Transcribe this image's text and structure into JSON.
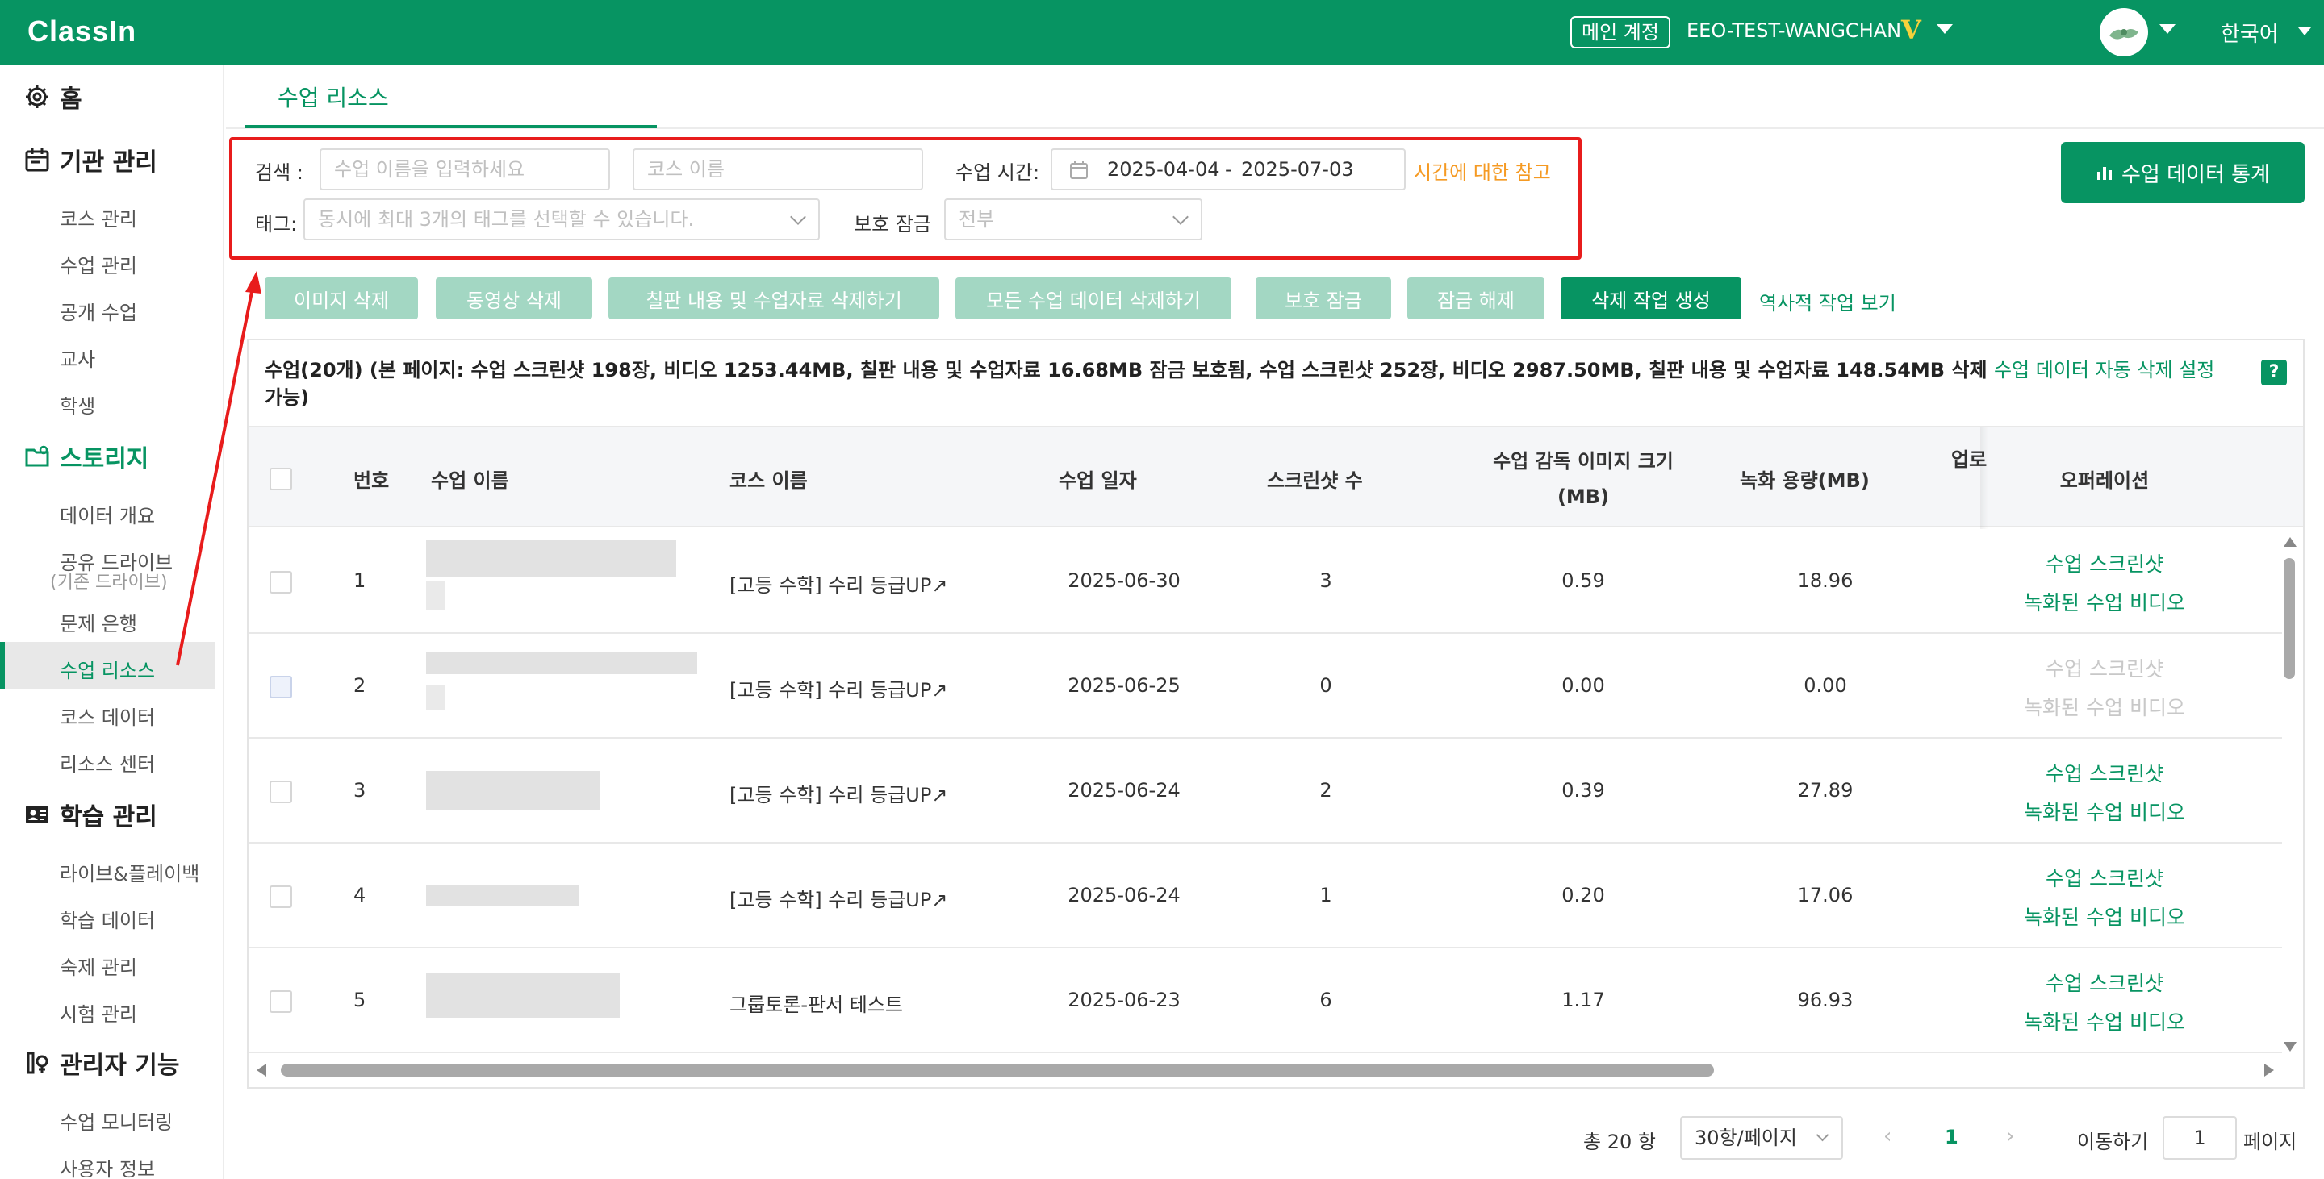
{
  "header": {
    "logo": "ClassIn",
    "account_badge": "메인 계정",
    "account_name": "EEO-TEST-WANGCHAN",
    "vip_mark": "V",
    "language": "한국어"
  },
  "sidebar": {
    "home": "홈",
    "org_mgmt": "기관 관리",
    "org_items": [
      "코스 관리",
      "수업 관리",
      "공개 수업",
      "교사",
      "학생"
    ],
    "storage": "스토리지",
    "storage_items": [
      "데이터 개요",
      "공유 드라이브",
      "(기존 드라이브)",
      "문제 은행",
      "수업 리소스",
      "코스 데이터",
      "리소스 센터"
    ],
    "learning": "학습 관리",
    "learning_items": [
      "라이브&플레이백",
      "학습 데이터",
      "숙제 관리",
      "시험 관리"
    ],
    "admin": "관리자 기능",
    "admin_items": [
      "수업 모니터링",
      "사용자 정보"
    ]
  },
  "tab": "수업 리소스",
  "filters": {
    "search_label": "검색 :",
    "search_placeholder": "수업 이름을 입력하세요",
    "course_placeholder": "코스 이름",
    "time_label": "수업 시간:",
    "date_start": "2025-04-04",
    "date_sep": "-",
    "date_end": "2025-07-03",
    "time_note": "시간에 대한 참고",
    "tag_label": "태그:",
    "tag_placeholder": "동시에 최대 3개의 태그를 선택할 수 있습니다.",
    "lock_label": "보호 잠금",
    "lock_value": "전부"
  },
  "stats_button": "수업 데이터 통계",
  "actions": {
    "delete_images": "이미지 삭제",
    "delete_videos": "동영상 삭제",
    "delete_board": "칠판 내용 및 수업자료 삭제하기",
    "delete_all": "모든 수업 데이터 삭제하기",
    "lock": "보호 잠금",
    "unlock": "잠금 해제",
    "create_task": "삭제 작업 생성",
    "history": "역사적 작업 보기"
  },
  "summary": {
    "text_line1": "수업(20개)   (본 페이지: 수업 스크린샷 198장, 비디오 1253.44MB, 칠판 내용 및 수업자료 16.68MB 잠금 보호됨, 수업 스크린샷 252장, 비디오 2987.50MB, 칠판 내용 및 수업자료 148.54MB 삭제",
    "text_line2": "가능)",
    "auto_delete_link": "수업 데이터 자동 삭제 설정",
    "help": "?"
  },
  "columns": {
    "no": "번호",
    "lesson": "수업 이름",
    "course": "코스 이름",
    "date": "수업 일자",
    "shots": "스크린샷 수",
    "img_size_1": "수업 감독 이미지 크기",
    "img_size_2": "(MB)",
    "video": "녹화 용량(MB)",
    "upload": "업로",
    "ops": "오퍼레이션"
  },
  "rows": [
    {
      "no": "1",
      "course": "[고등 수학] 수리 등급UP↗",
      "date": "2025-06-30",
      "shots": "3",
      "img": "0.59",
      "video": "18.96",
      "enabled": true
    },
    {
      "no": "2",
      "course": "[고등 수학] 수리 등급UP↗",
      "date": "2025-06-25",
      "shots": "0",
      "img": "0.00",
      "video": "0.00",
      "enabled": false
    },
    {
      "no": "3",
      "course": "[고등 수학] 수리 등급UP↗",
      "date": "2025-06-24",
      "shots": "2",
      "img": "0.39",
      "video": "27.89",
      "enabled": true
    },
    {
      "no": "4",
      "course": "[고등 수학] 수리 등급UP↗",
      "date": "2025-06-24",
      "shots": "1",
      "img": "0.20",
      "video": "17.06",
      "enabled": true
    },
    {
      "no": "5",
      "course": "그룹토론-판서 테스트",
      "date": "2025-06-23",
      "shots": "6",
      "img": "1.17",
      "video": "96.93",
      "enabled": true
    }
  ],
  "op_labels": {
    "screenshot": "수업 스크린샷",
    "video": "녹화된 수업 비디오"
  },
  "pagination": {
    "total": "총 20 항",
    "page_size": "30항/페이지",
    "current": "1",
    "goto_label": "이동하기",
    "goto_value": "1",
    "page_suffix": "페이지"
  },
  "colors": {
    "brand": "#079462",
    "highlight": "#e81c1c",
    "note": "#f59a23"
  }
}
